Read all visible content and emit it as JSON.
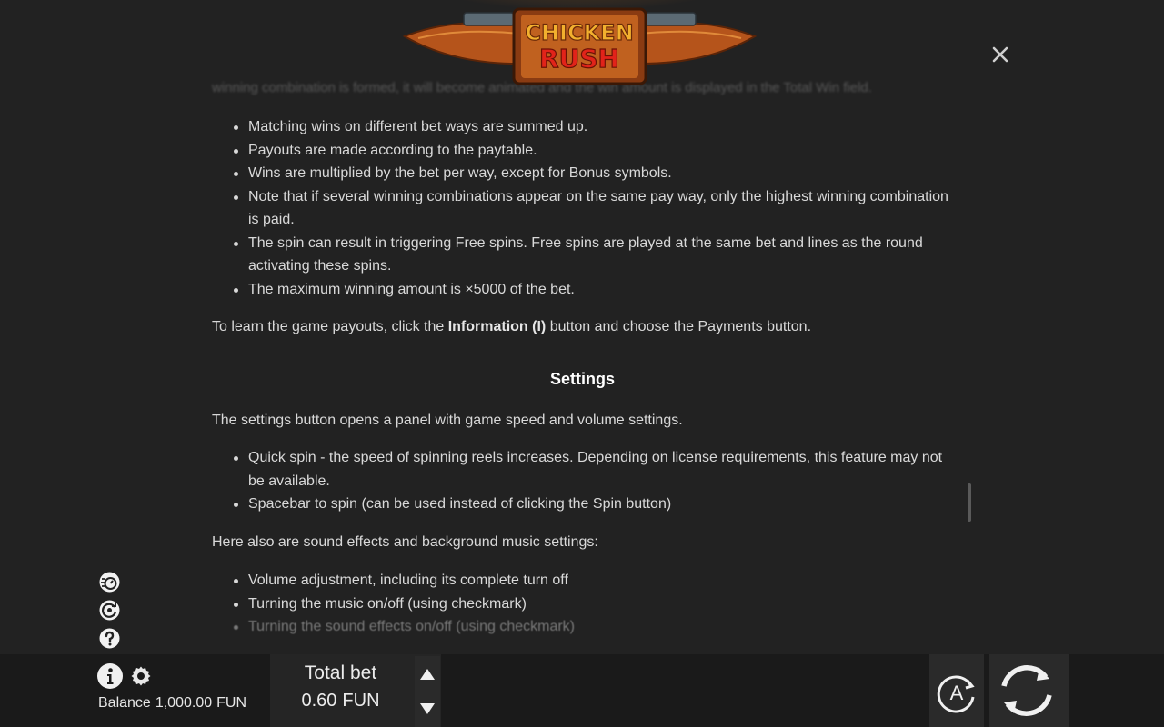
{
  "game": {
    "logo_text_line1": "CHICKEN",
    "logo_text_line2": "RUSH"
  },
  "rules": {
    "faded_top_line": "winning combination is formed, it will become animated and the win amount is displayed in the Total Win field.",
    "list1": [
      "Matching wins on different bet ways are summed up.",
      "Payouts are made according to the paytable.",
      "Wins are multiplied by the bet per way, except for Bonus symbols.",
      "Note that if several winning combinations appear on the same pay way, only the highest winning combination is paid.",
      "The spin can result in triggering Free spins. Free spins are played at the same bet and lines as the round activating these spins.",
      "The maximum winning amount is ×5000 of the bet."
    ],
    "payouts_para": {
      "before": "To learn the game payouts, click the ",
      "bold": "Information (I)",
      "after": " button and choose the Payments button."
    },
    "settings_heading": "Settings",
    "settings_intro": "The settings button opens a panel with game speed and volume settings.",
    "list2": [
      "Quick spin - the speed of spinning reels increases. Depending on license requirements, this feature may not be available.",
      "Spacebar to spin (can be used instead of clicking the Spin button)"
    ],
    "sound_intro": "Here also are sound effects and background music settings:",
    "list3": [
      "Volume adjustment, including its complete turn off",
      "Turning the music on/off (using checkmark)",
      "Turning the sound effects on/off (using checkmark)"
    ]
  },
  "bottom_bar": {
    "balance_label": "Balance",
    "balance_value": "1,000.00",
    "balance_currency": "FUN",
    "total_bet_label": "Total bet",
    "total_bet_value": "0.60",
    "total_bet_currency": "FUN",
    "autoplay_letter": "A"
  },
  "colors": {
    "background": "#222222",
    "bar": "#1a1a1a",
    "text": "#d9d9d9",
    "logo_wood": "#b5541b",
    "logo_gold": "#f2b02e",
    "logo_red": "#e2231a"
  }
}
